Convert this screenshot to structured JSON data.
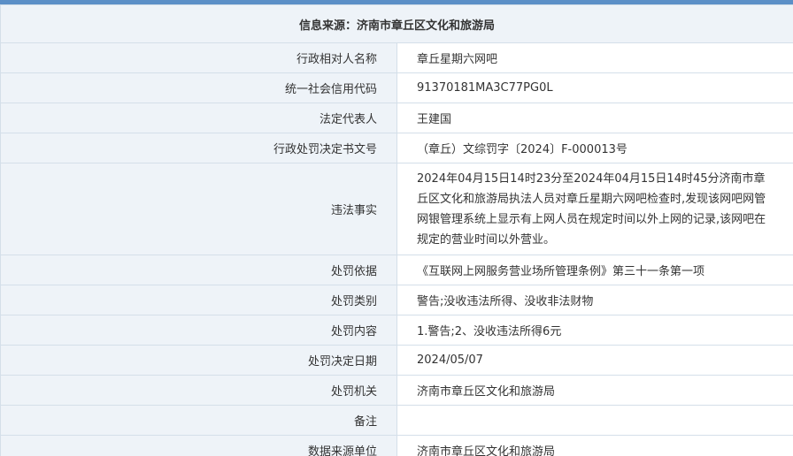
{
  "header": {
    "title": "信息来源：济南市章丘区文化和旅游局"
  },
  "rows": [
    {
      "label": "行政相对人名称",
      "value": "章丘星期六网吧"
    },
    {
      "label": "统一社会信用代码",
      "value": "91370181MA3C77PG0L"
    },
    {
      "label": "法定代表人",
      "value": "王建国"
    },
    {
      "label": "行政处罚决定书文号",
      "value": "（章丘）文综罚字〔2024〕F-000013号"
    },
    {
      "label": "违法事实",
      "value": "2024年04月15日14时23分至2024年04月15日14时45分济南市章丘区文化和旅游局执法人员对章丘星期六网吧检查时,发现该网吧网管网银管理系统上显示有上网人员在规定时间以外上网的记录,该网吧在规定的营业时间以外营业。"
    },
    {
      "label": "处罚依据",
      "value": "《互联网上网服务营业场所管理条例》第三十一条第一项"
    },
    {
      "label": "处罚类别",
      "value": "警告;没收违法所得、没收非法财物"
    },
    {
      "label": "处罚内容",
      "value": "1.警告;2、没收违法所得6元"
    },
    {
      "label": "处罚决定日期",
      "value": "2024/05/07"
    },
    {
      "label": "处罚机关",
      "value": "济南市章丘区文化和旅游局"
    },
    {
      "label": "备注",
      "value": ""
    },
    {
      "label": "数据来源单位",
      "value": "济南市章丘区文化和旅游局"
    }
  ],
  "colors": {
    "accent_bar": "#5b8fc7",
    "label_bg": "#eef3f8",
    "border": "#d4dfe9"
  }
}
